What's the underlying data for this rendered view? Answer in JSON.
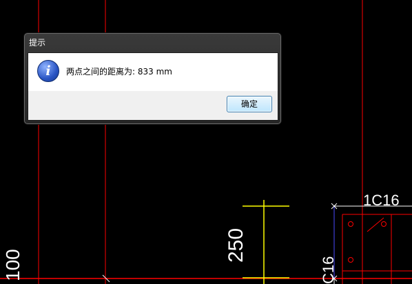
{
  "cad": {
    "dim_250": "250",
    "dim_100": "100",
    "label_1c16": "1C16",
    "label_c16": "C16"
  },
  "dialog": {
    "title": "提示",
    "icon": "info-icon",
    "message": "两点之间的距离为: 833 mm",
    "ok_label": "确定"
  },
  "colors": {
    "background": "#000000",
    "red_line": "#ff0000",
    "yellow_line": "#ffff00",
    "white_text": "#ffffff",
    "blue_line": "#4a4aff"
  }
}
